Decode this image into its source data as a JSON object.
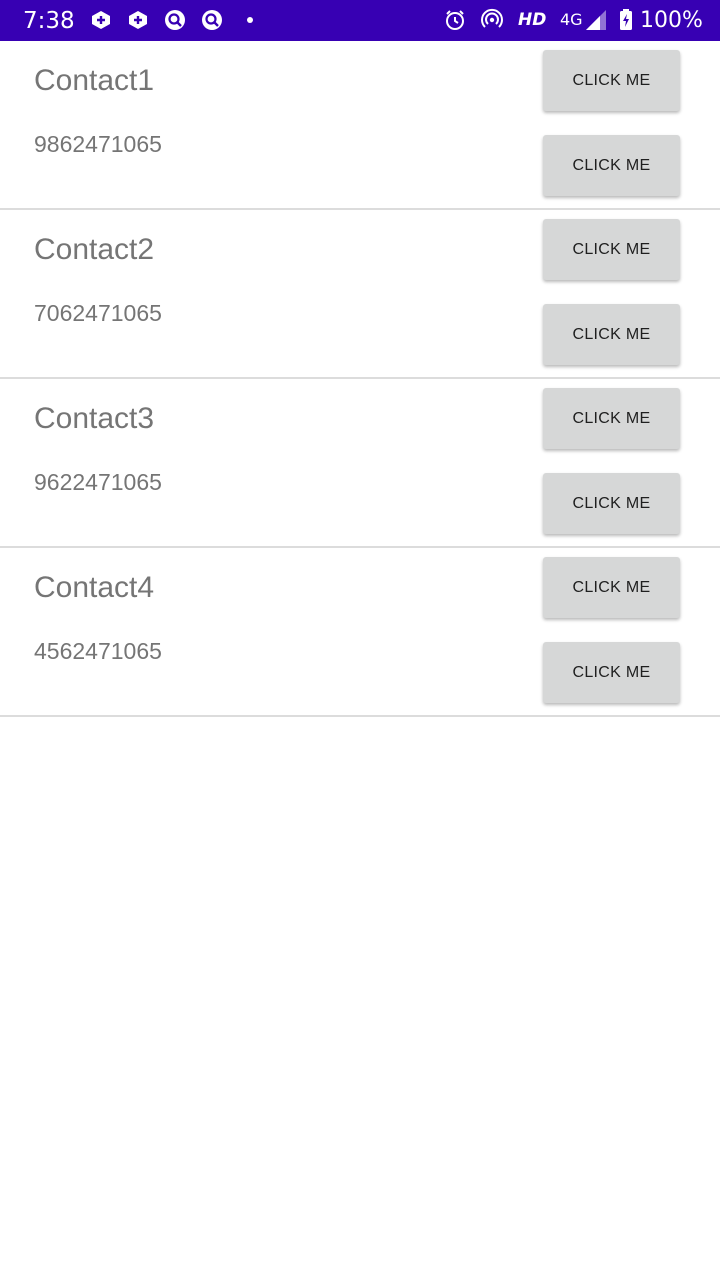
{
  "status_bar": {
    "time": "7:38",
    "hd": "HD",
    "network": "4G",
    "battery": "100%",
    "background_color": "#3700b3",
    "icons": [
      "notification-app-icon",
      "notification-app-icon",
      "notification-chat-icon",
      "notification-chat-icon",
      "notification-dot-icon",
      "alarm-icon",
      "hotspot-icon",
      "signal-icon",
      "battery-charging-icon"
    ]
  },
  "contacts": [
    {
      "name": "Contact1",
      "phone": "9862471065",
      "button_top": "CLICK ME",
      "button_bottom": "CLICK ME"
    },
    {
      "name": "Contact2",
      "phone": "7062471065",
      "button_top": "CLICK ME",
      "button_bottom": "CLICK ME"
    },
    {
      "name": "Contact3",
      "phone": "9622471065",
      "button_top": "CLICK ME",
      "button_bottom": "CLICK ME"
    },
    {
      "name": "Contact4",
      "phone": "4562471065",
      "button_top": "CLICK ME",
      "button_bottom": "CLICK ME"
    }
  ]
}
